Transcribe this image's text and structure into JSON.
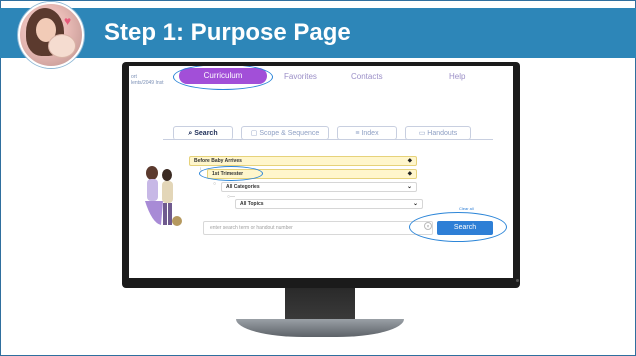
{
  "header": {
    "title": "Step 1: Purpose Page",
    "band_color": "#2d86b8"
  },
  "app": {
    "brand_lines": [
      "ort",
      "lents/2049 Inst"
    ],
    "nav": {
      "active": "Curriculum",
      "items": [
        "Favorites",
        "Contacts",
        "Help"
      ]
    },
    "tabs": [
      "Search",
      "Scope & Sequence",
      "Index",
      "Handouts"
    ],
    "filters": {
      "level1": "Before Baby Arrives",
      "level2": "1st Trimester",
      "level3": "All Categories",
      "level4": "All Topics"
    },
    "small_link": "Clear all",
    "search": {
      "placeholder": "enter search term or handout number",
      "button": "Search"
    },
    "highlight_color": "#2d86d8",
    "accent_purple": "#a24fd8",
    "button_blue": "#2e7fd6"
  }
}
